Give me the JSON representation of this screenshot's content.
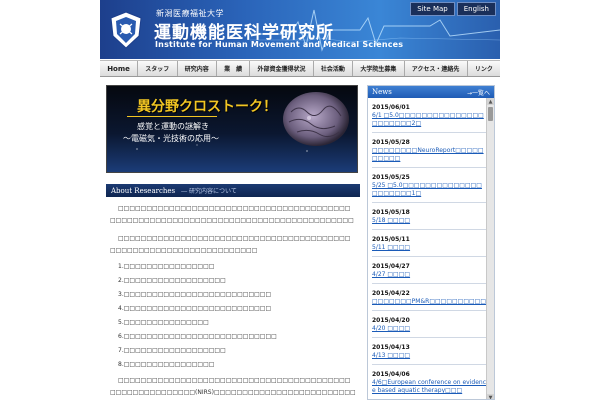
{
  "header": {
    "university": "新潟医療福祉大学",
    "institute_jp": "運動機能医科学研究所",
    "institute_en": "Institute for Human Movement and Medical Sciences",
    "links": [
      "Site Map",
      "English"
    ],
    "colors": {
      "bar_dark": "#1d3f8c",
      "bar_light": "#3a86d6"
    }
  },
  "nav": {
    "items": [
      "Home",
      "スタッフ",
      "研究内容",
      "業　績",
      "外部資金獲得状況",
      "社会活動",
      "大学院生募集",
      "アクセス・連絡先",
      "リンク"
    ]
  },
  "banner": {
    "title": "異分野クロストーク！",
    "subtitle1": "感覚と運動の謎解き",
    "subtitle2": "～電磁気・光技術の応用～",
    "title_color": "#f2c623"
  },
  "about": {
    "title": "About Researches",
    "subtitle": "― 研究内容について"
  },
  "article": {
    "paragraph1": "□□□□□□□□□□□□□□□□□□□□□□□□□□□□□□□□□□□□□□□□□□□□□□□□□□□□□□□□□□□□□□□□□□□□□□□□□□□□□□□□□□□□",
    "paragraph2": "□□□□□□□□□□□□□□□□□□□□□□□□□□□□□□□□□□□□□□□□□□□□□□□□□□□□□□□□□□□□□□□□□□□",
    "list": [
      "1.□□□□□□□□□□□□□□□□",
      "2.□□□□□□□□□□□□□□□□□□",
      "3.□□□□□□□□□□□□□□□□□□□□□□□□□□",
      "4.□□□□□□□□□□□□□□□□□□□□□□□□□□",
      "5.□□□□□□□□□□□□□□□",
      "6.□□□□□□□□□□□□□□□□□□□□□□□□□□□",
      "7.□□□□□□□□□□□□□□□□□□",
      "8.□□□□□□□□□□□□□□□□"
    ],
    "paragraph3": "□□□□□□□□□□□□□□□□□□□□□□□□□□□□□□□□□□□□□□□□□□□□□□□□□□□□□□□□(NIRS)□□□□□□□□□□□□□□□□□□□□□□□□□□□□□□□□□□□□□□□□□□"
  },
  "news": {
    "title": "News",
    "more": "→一覧へ",
    "items": [
      {
        "date": "2015/06/01",
        "text": "6/1 □5.0□□□□□□□□□□□□□□□□□□□□□□2□"
      },
      {
        "date": "2015/05/28",
        "text": "□□□□□□□□NeuroReport□□□□□□□□□□"
      },
      {
        "date": "2015/05/25",
        "text": "5/25 □5.0□□□□□□□□□□□□□□□□□□□□□1□"
      },
      {
        "date": "2015/05/18",
        "text": "5/18 □□□□"
      },
      {
        "date": "2015/05/11",
        "text": "5/11 □□□□"
      },
      {
        "date": "2015/04/27",
        "text": "4/27 □□□□"
      },
      {
        "date": "2015/04/22",
        "text": "□□□□□□□PM&R□□□□□□□□□□"
      },
      {
        "date": "2015/04/20",
        "text": "4/20 □□□□"
      },
      {
        "date": "2015/04/13",
        "text": "4/13 □□□□"
      },
      {
        "date": "2015/04/06",
        "text": "4/6□European conference on evidence based aquatic therapy□□□"
      }
    ]
  }
}
